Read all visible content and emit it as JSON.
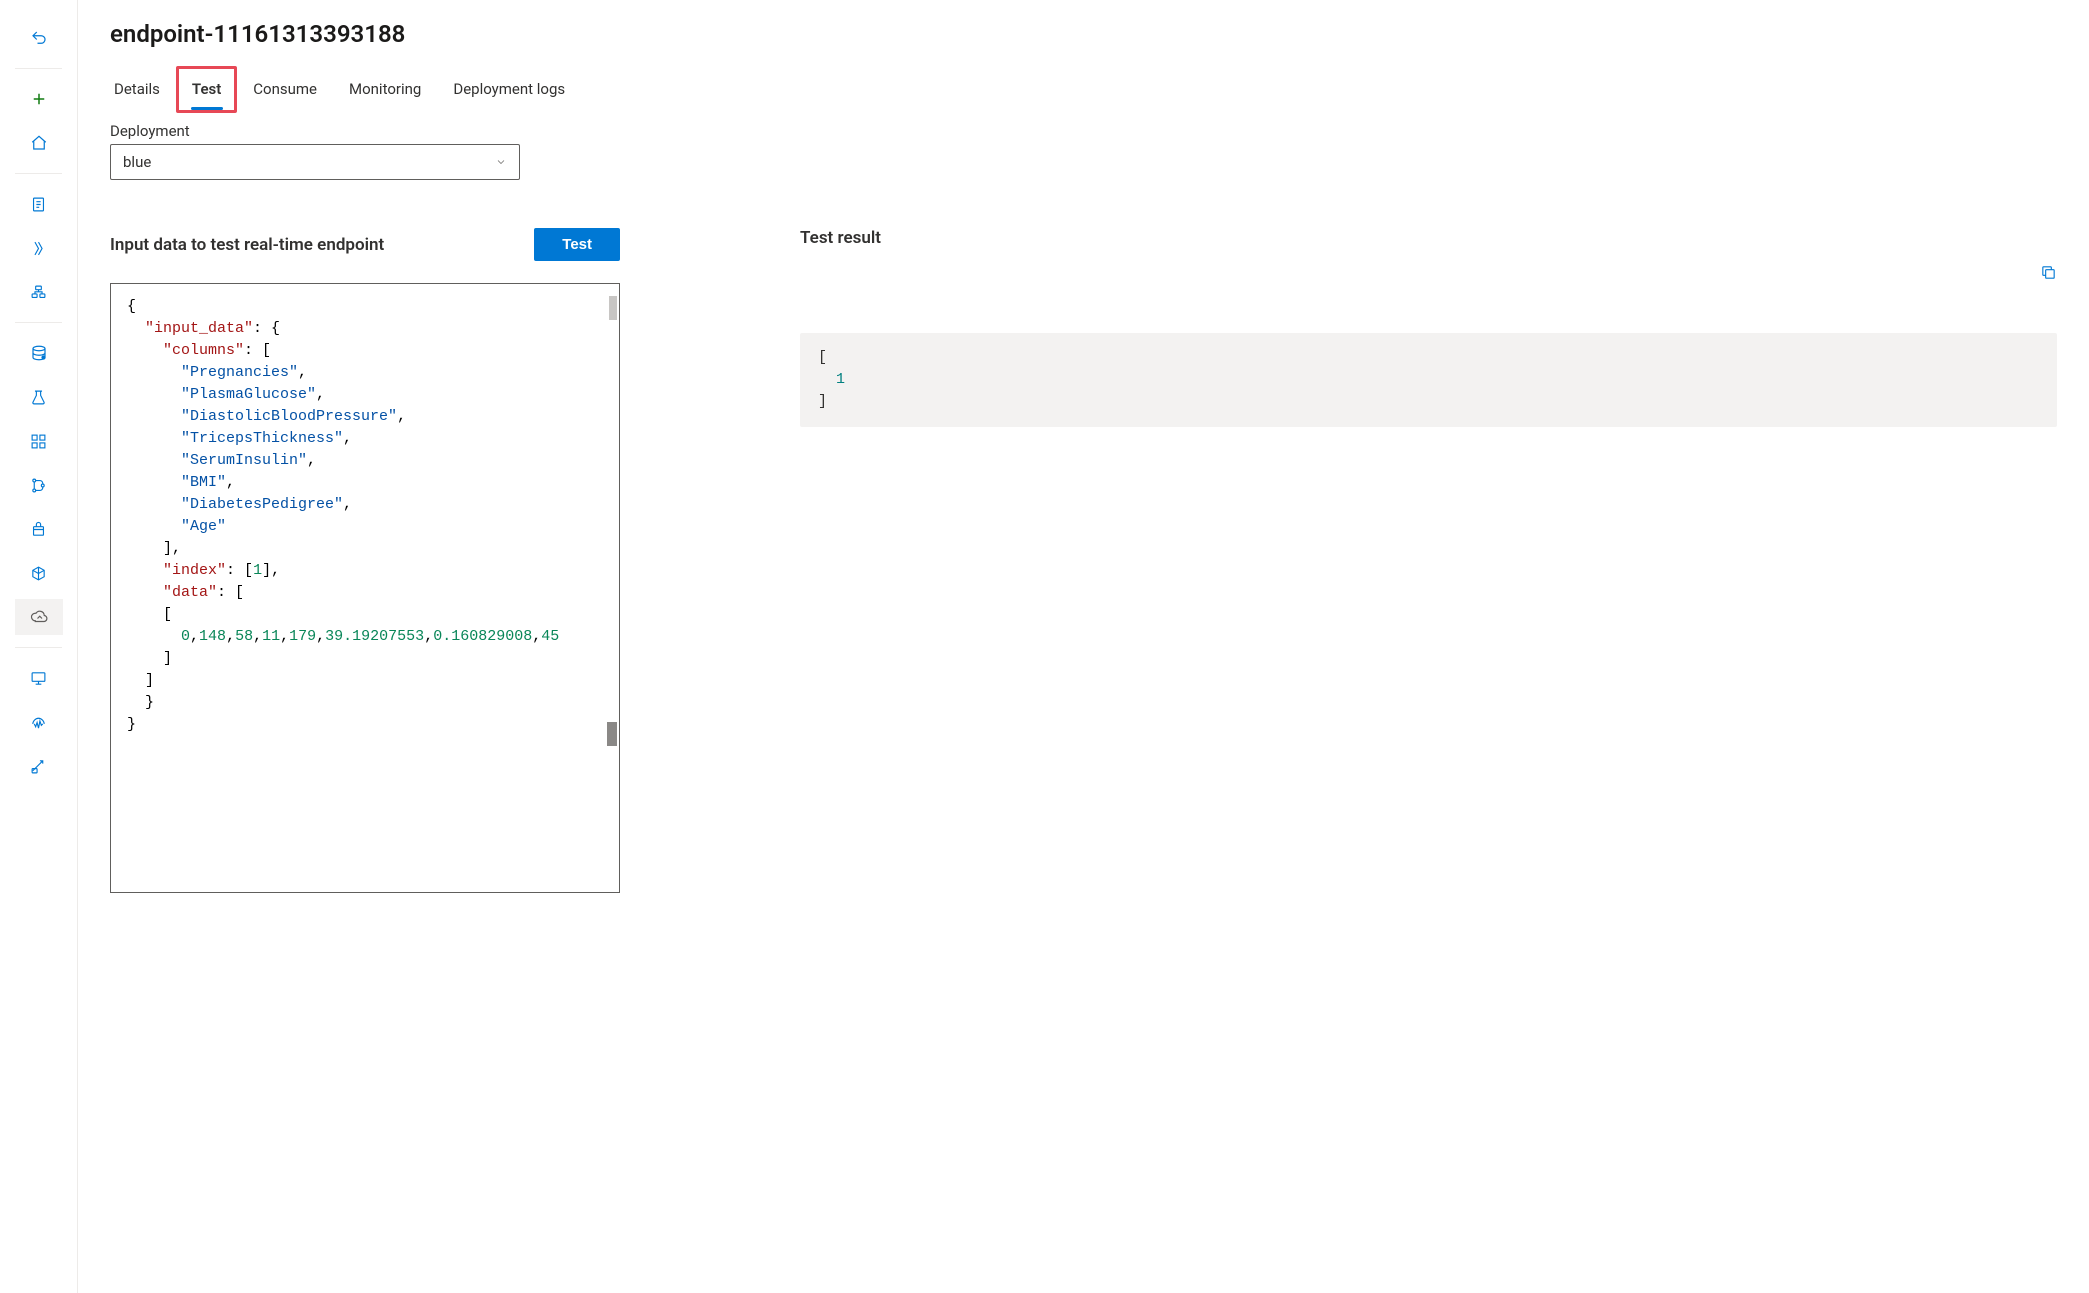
{
  "page_title": "endpoint-11161313393188",
  "tabs": {
    "details": "Details",
    "test": "Test",
    "consume": "Consume",
    "monitoring": "Monitoring",
    "deployment_logs": "Deployment logs"
  },
  "deployment": {
    "label": "Deployment",
    "value": "blue"
  },
  "input_section": {
    "title": "Input data to test real-time endpoint",
    "test_button": "Test"
  },
  "input_json": {
    "root_key": "input_data",
    "columns_key": "columns",
    "columns": [
      "Pregnancies",
      "PlasmaGlucose",
      "DiastolicBloodPressure",
      "TricepsThickness",
      "SerumInsulin",
      "BMI",
      "DiabetesPedigree",
      "Age"
    ],
    "index_key": "index",
    "index_values": "[1]",
    "data_key": "data",
    "data_row": "0,148,58,11,179,39.19207553,0.160829008,45"
  },
  "result_section": {
    "title": "Test result",
    "result_value": "1"
  }
}
